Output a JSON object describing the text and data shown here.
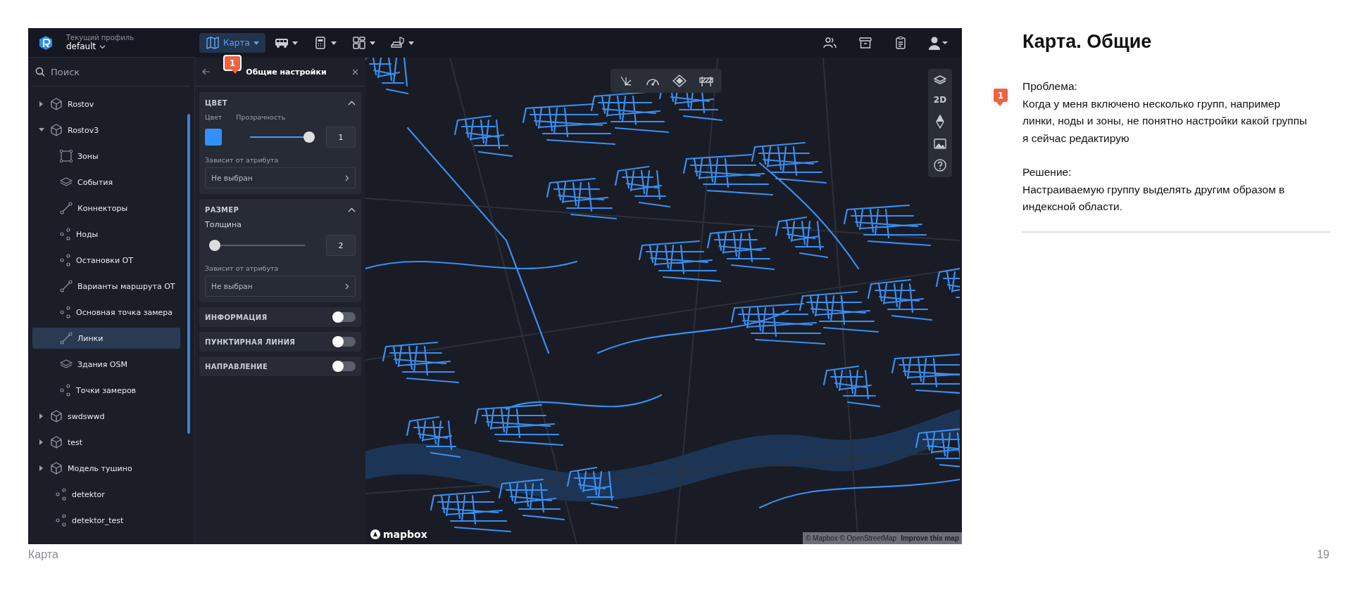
{
  "app": {
    "profile": {
      "label": "Текущий профиль",
      "value": "default"
    },
    "search": {
      "placeholder": "Поиск"
    },
    "tree": [
      {
        "label": "Rostov",
        "kind": "model",
        "expanded": false,
        "selected": false
      },
      {
        "label": "Rostov3",
        "kind": "model",
        "expanded": true,
        "selected": false,
        "children": [
          {
            "label": "Зоны",
            "kind": "zone",
            "selected": false
          },
          {
            "label": "События",
            "kind": "layers",
            "selected": false
          },
          {
            "label": "Коннекторы",
            "kind": "line",
            "selected": false
          },
          {
            "label": "Ноды",
            "kind": "points",
            "selected": false
          },
          {
            "label": "Остановки ОТ",
            "kind": "points",
            "selected": false
          },
          {
            "label": "Варианты маршрута ОТ",
            "kind": "line",
            "selected": false
          },
          {
            "label": "Основная точка замера",
            "kind": "points",
            "selected": false
          },
          {
            "label": "Линки",
            "kind": "line",
            "selected": true
          },
          {
            "label": "Здания OSM",
            "kind": "layers",
            "selected": false
          },
          {
            "label": "Точки замеров",
            "kind": "points",
            "selected": false
          }
        ]
      },
      {
        "label": "swdswwd",
        "kind": "model",
        "expanded": false,
        "selected": false
      },
      {
        "label": "test",
        "kind": "model",
        "expanded": false,
        "selected": false
      },
      {
        "label": "Модель тушино",
        "kind": "model",
        "expanded": false,
        "selected": false
      },
      {
        "label": "detektor",
        "kind": "points",
        "selected": false
      },
      {
        "label": "detektor_test",
        "kind": "points",
        "selected": false
      }
    ],
    "toolbar": [
      {
        "kind": "map",
        "label": "Карта",
        "selected": true
      },
      {
        "kind": "bus",
        "selected": false
      },
      {
        "kind": "calculator",
        "selected": false
      },
      {
        "kind": "dashboard",
        "selected": false
      },
      {
        "kind": "car",
        "selected": false
      }
    ],
    "toolbar_right": [
      {
        "kind": "users"
      },
      {
        "kind": "archive"
      },
      {
        "kind": "clipboard"
      },
      {
        "kind": "avatar"
      }
    ],
    "settings": {
      "title": "Общие настройки",
      "badge": "1",
      "sections": [
        {
          "kind": "color",
          "title": "ЦВЕТ",
          "expanded": true,
          "color_label": "Цвет",
          "opacity_label": "Прозрачность",
          "color": "#3391ff",
          "level": 1,
          "value": "1",
          "attr_label": "Зависит от атрибута",
          "attr_value": "Не выбран"
        },
        {
          "kind": "size",
          "title": "РАЗМЕР",
          "expanded": true,
          "label": "Толщина",
          "level": 0,
          "value": "2",
          "attr_label": "Зависит от атрибута",
          "attr_value": "Не выбран"
        },
        {
          "kind": "toggle",
          "title": "ИНФОРМАЦИЯ",
          "on": false
        },
        {
          "kind": "toggle",
          "title": "ПУНКТИРНАЯ ЛИНИЯ",
          "on": false
        },
        {
          "kind": "toggle",
          "title": "НАПРАВЛЕНИЕ",
          "on": false
        }
      ]
    },
    "map": {
      "tools": [
        {
          "kind": "fork"
        },
        {
          "kind": "speed"
        },
        {
          "kind": "diamond"
        },
        {
          "kind": "barrier"
        }
      ],
      "controls": [
        {
          "kind": "layers"
        },
        {
          "kind": "text",
          "label": "2D"
        },
        {
          "kind": "compass"
        },
        {
          "kind": "image"
        },
        {
          "kind": "help"
        }
      ],
      "logo": "mapbox",
      "attribution": "© Mapbox © OpenStreetMap",
      "improve": "Improve this map"
    }
  },
  "note": {
    "title": "Карта. Общие",
    "badge": "1",
    "problem_label": "Проблема:",
    "problem": "Когда у меня включено несколько групп, например линки, ноды и зоны, не понятно настройки какой группы я сейчас редактирую",
    "solution_label": "Решение:",
    "solution": "Настраиваемую группу выделять другим образом в индексной области."
  },
  "footer": {
    "section": "Карта",
    "page": "19"
  }
}
